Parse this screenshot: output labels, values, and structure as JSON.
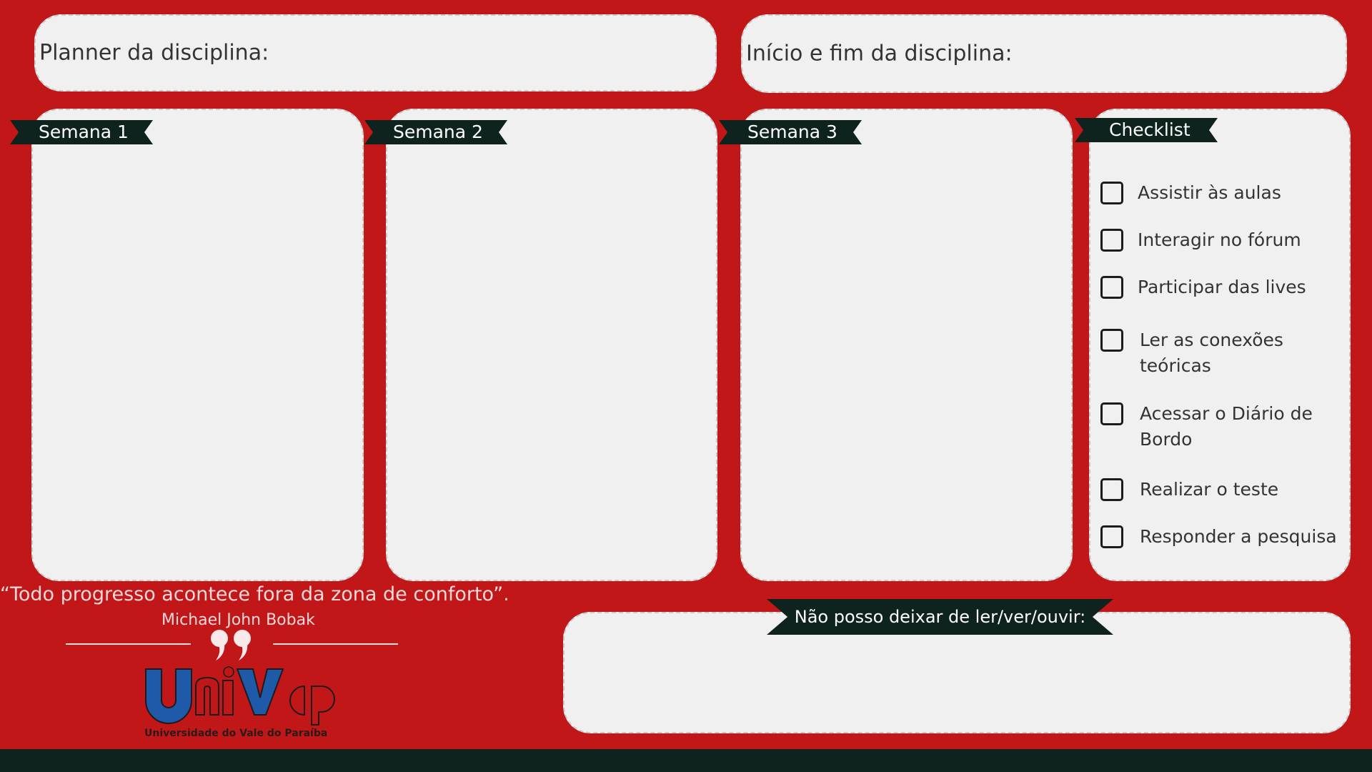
{
  "header": {
    "planner_label": "Planner da disciplina:",
    "dates_label": "Início e fim da disciplina:"
  },
  "weeks": [
    {
      "label": "Semana 1"
    },
    {
      "label": "Semana 2"
    },
    {
      "label": "Semana 3"
    }
  ],
  "checklist": {
    "title": "Checklist",
    "items": [
      {
        "label": "Assistir às aulas",
        "checked": false
      },
      {
        "label": "Interagir no fórum",
        "checked": false
      },
      {
        "label": "Participar das lives",
        "checked": false
      },
      {
        "label": "Ler as conexões teóricas",
        "checked": false
      },
      {
        "label": "Acessar o Diário de Bordo",
        "checked": false
      },
      {
        "label": "Realizar o teste",
        "checked": false
      },
      {
        "label": "Responder a pesquisa",
        "checked": false
      }
    ]
  },
  "quote": {
    "text": "“Todo progresso acontece fora da zona de conforto”.",
    "author": "Michael John Bobak",
    "icon": "quote-mark-icon"
  },
  "logo": {
    "wordmark": "UniVap",
    "caption": "Universidade do Vale do Paraíba"
  },
  "must_see": {
    "title": "Não posso deixar de ler/ver/ouvir:"
  },
  "colors": {
    "background": "#c21719",
    "card": "#f0f0f0",
    "ribbon": "#0f231e",
    "logo_blue": "#1e5aa8"
  }
}
